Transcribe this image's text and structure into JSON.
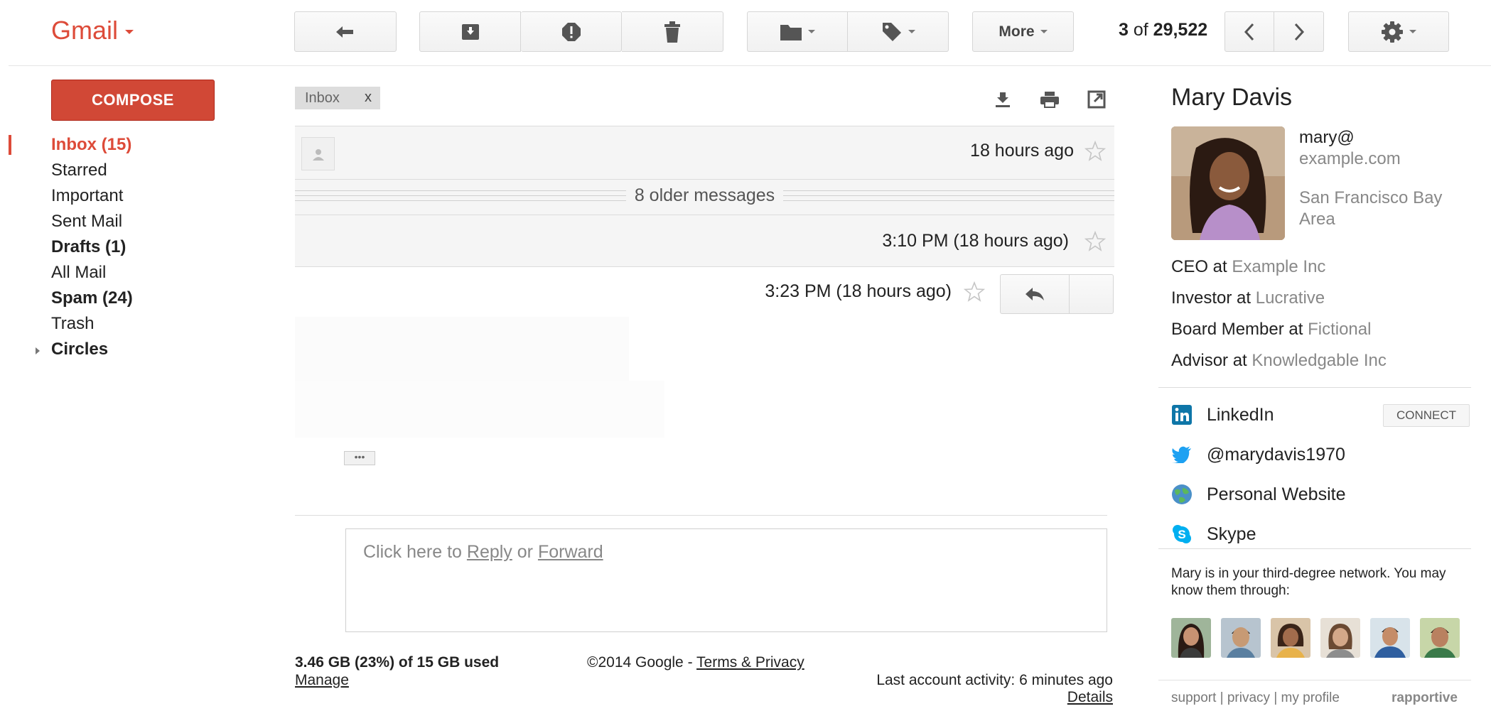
{
  "app": {
    "logo": "Gmail"
  },
  "toolbar": {
    "more_label": "More",
    "pager": {
      "position": "3",
      "of_label": "of",
      "total": "29,522"
    }
  },
  "sidebar": {
    "compose_label": "COMPOSE",
    "items": [
      {
        "label": "Inbox (15)"
      },
      {
        "label": "Starred"
      },
      {
        "label": "Important"
      },
      {
        "label": "Sent Mail"
      },
      {
        "label": "Drafts (1)"
      },
      {
        "label": "All Mail"
      },
      {
        "label": "Spam (24)"
      },
      {
        "label": "Trash"
      },
      {
        "label": "Circles"
      }
    ]
  },
  "thread": {
    "label_chip": "Inbox",
    "label_chip_close": "x",
    "messages": [
      {
        "time": "18 hours ago"
      },
      {
        "time": "3:10 PM (18 hours ago)"
      },
      {
        "time": "3:23 PM (18 hours ago)"
      }
    ],
    "older_messages": "8 older messages",
    "ellipsis": "•••",
    "reply_box": {
      "prefix": "Click here to ",
      "reply": "Reply",
      "or": " or ",
      "forward": "Forward"
    }
  },
  "footer": {
    "storage": "3.46 GB (23%) of 15 GB used",
    "manage": "Manage",
    "copyright": "©2014 Google - ",
    "terms": "Terms & Privacy",
    "activity": "Last account activity: 6 minutes ago",
    "details": "Details"
  },
  "contact": {
    "name": "Mary Davis",
    "email_line1": "mary@",
    "email_line2": "example.com",
    "location": "San Francisco Bay Area",
    "jobs": [
      {
        "role": "CEO at ",
        "org": "Example Inc"
      },
      {
        "role": "Investor at ",
        "org": "Lucrative"
      },
      {
        "role": "Board Member at ",
        "org": "Fictional"
      },
      {
        "role": "Advisor at ",
        "org": "Knowledgable Inc"
      }
    ],
    "links": [
      {
        "label": "LinkedIn",
        "icon": "linkedin-icon"
      },
      {
        "label": "@marydavis1970",
        "icon": "twitter-icon"
      },
      {
        "label": "Personal Website",
        "icon": "globe-icon"
      },
      {
        "label": "Skype",
        "icon": "skype-icon"
      }
    ],
    "connect_label": "CONNECT",
    "network_text": "Mary is in your third-degree network. You may know them through:",
    "footer_links": "support | privacy | my profile",
    "brand": "rapportive"
  },
  "colors": {
    "accent": "#dd4b39",
    "compose": "#d14836",
    "linkedin": "#0e76a8",
    "twitter": "#1da1f2",
    "skype": "#00aff0"
  }
}
